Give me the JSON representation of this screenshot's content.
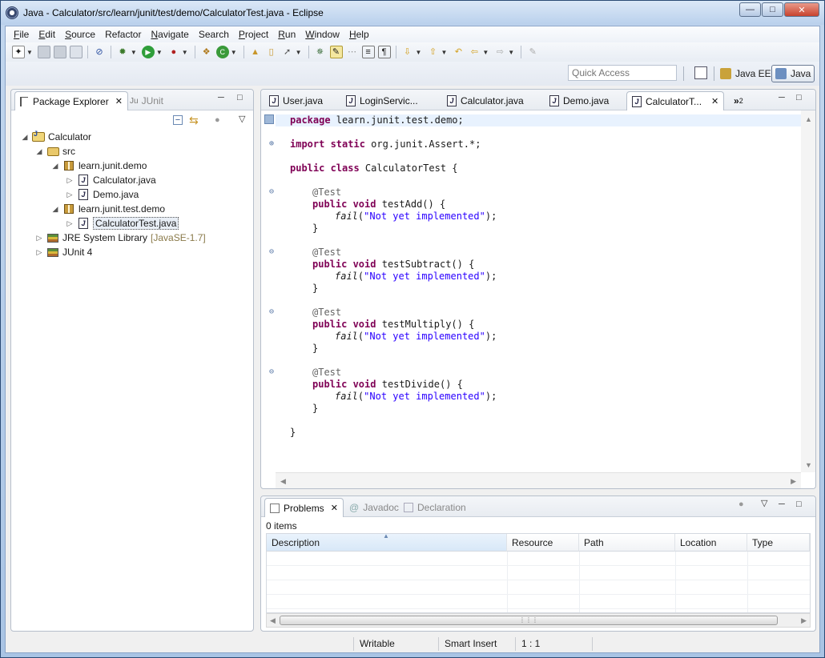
{
  "window": {
    "title": "Java - Calculator/src/learn/junit/test/demo/CalculatorTest.java - Eclipse",
    "controls": [
      "minimize",
      "maximize",
      "close"
    ]
  },
  "menubar": {
    "items": [
      {
        "label": "File",
        "mnemonic": "F",
        "rest": "ile"
      },
      {
        "label": "Edit",
        "mnemonic": "E",
        "rest": "dit"
      },
      {
        "label": "Source",
        "mnemonic": "S",
        "rest": "ource"
      },
      {
        "label": "Refactor",
        "mnemonic": "",
        "rest": "Refactor"
      },
      {
        "label": "Navigate",
        "mnemonic": "N",
        "rest": "avigate"
      },
      {
        "label": "Search",
        "mnemonic": "",
        "rest": "Search"
      },
      {
        "label": "Project",
        "mnemonic": "P",
        "rest": "roject"
      },
      {
        "label": "Run",
        "mnemonic": "R",
        "rest": "un"
      },
      {
        "label": "Window",
        "mnemonic": "W",
        "rest": "indow"
      },
      {
        "label": "Help",
        "mnemonic": "H",
        "rest": "elp"
      }
    ]
  },
  "toolbar": {
    "quick_access_placeholder": "Quick Access",
    "perspectives": [
      {
        "label": "Java EE",
        "active": false
      },
      {
        "label": "Java",
        "active": true
      }
    ]
  },
  "package_explorer": {
    "tabs": [
      {
        "label": "Package Explorer",
        "active": true
      },
      {
        "label": "JUnit",
        "active": false
      }
    ],
    "tree": [
      {
        "label": "Calculator",
        "level": 0,
        "expanded": true,
        "icon": "project-icon"
      },
      {
        "label": "src",
        "level": 1,
        "expanded": true,
        "icon": "source-folder-icon"
      },
      {
        "label": "learn.junit.demo",
        "level": 2,
        "expanded": true,
        "icon": "package-icon"
      },
      {
        "label": "Calculator.java",
        "level": 3,
        "expanded": false,
        "icon": "java-file-icon"
      },
      {
        "label": "Demo.java",
        "level": 3,
        "expanded": false,
        "icon": "java-file-icon"
      },
      {
        "label": "learn.junit.test.demo",
        "level": 2,
        "expanded": true,
        "icon": "package-icon"
      },
      {
        "label": "CalculatorTest.java",
        "level": 3,
        "expanded": false,
        "icon": "java-file-icon",
        "selected": true
      },
      {
        "label": "JRE System Library",
        "suffix": "[JavaSE-1.7]",
        "level": 1,
        "expanded": false,
        "icon": "library-icon"
      },
      {
        "label": "JUnit 4",
        "level": 1,
        "expanded": false,
        "icon": "library-icon"
      }
    ]
  },
  "editor": {
    "tabs": [
      {
        "label": "User.java",
        "active": false
      },
      {
        "label": "LoginServic...",
        "active": false
      },
      {
        "label": "Calculator.java",
        "active": false
      },
      {
        "label": "Demo.java",
        "active": false
      },
      {
        "label": "CalculatorT...",
        "active": true
      }
    ],
    "overflow_label": "»",
    "overflow_count": "2",
    "code": {
      "package_kw": "package",
      "package_name": " learn.junit.test.demo;",
      "import_kw": "import static",
      "import_name": " org.junit.Assert.*;",
      "class_kw": "public class",
      "class_name": " CalculatorTest {",
      "annotation": "@Test",
      "method_kw": "public void",
      "methods": [
        "testAdd",
        "testSubtract",
        "testMultiply",
        "testDivide"
      ],
      "method_suffix": "() {",
      "fail_call": "fail",
      "fail_open": "(",
      "fail_string": "\"Not yet implemented\"",
      "fail_close": ");",
      "close_brace": "}"
    }
  },
  "problems": {
    "tabs": [
      {
        "label": "Problems",
        "active": true
      },
      {
        "label": "Javadoc",
        "active": false
      },
      {
        "label": "Declaration",
        "active": false
      }
    ],
    "item_count": "0 items",
    "columns": [
      "Description",
      "Resource",
      "Path",
      "Location",
      "Type"
    ]
  },
  "statusbar": {
    "mode": "Writable",
    "insert_mode": "Smart Insert",
    "position": "1 : 1"
  }
}
